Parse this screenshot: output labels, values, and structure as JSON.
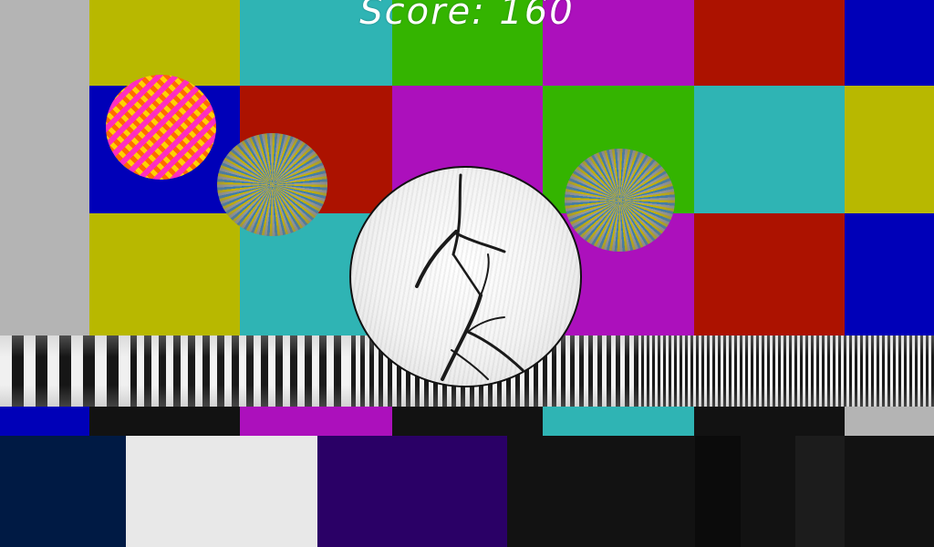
{
  "hud": {
    "score_text": "Score: 160"
  },
  "colors": {
    "gray": "#b4b4b4",
    "yellow": "#b8b800",
    "cyan": "#2fb4b4",
    "green": "#34b400",
    "magenta": "#ac10bc",
    "red": "#ac1200",
    "blue": "#0000b8",
    "black": "#121212",
    "white": "#e8e8e8",
    "navy": "#001a44",
    "purple": "#2a0066",
    "near_black": "#0b0b0b"
  },
  "balls": [
    {
      "name": "yellow-pattern-ball",
      "pattern": "yellow-magenta-dots"
    },
    {
      "name": "swirl-ball-left",
      "pattern": "radial-swirl"
    },
    {
      "name": "white-sketch-ball",
      "pattern": "branch-sketch"
    },
    {
      "name": "swirl-ball-right",
      "pattern": "radial-swirl"
    }
  ]
}
